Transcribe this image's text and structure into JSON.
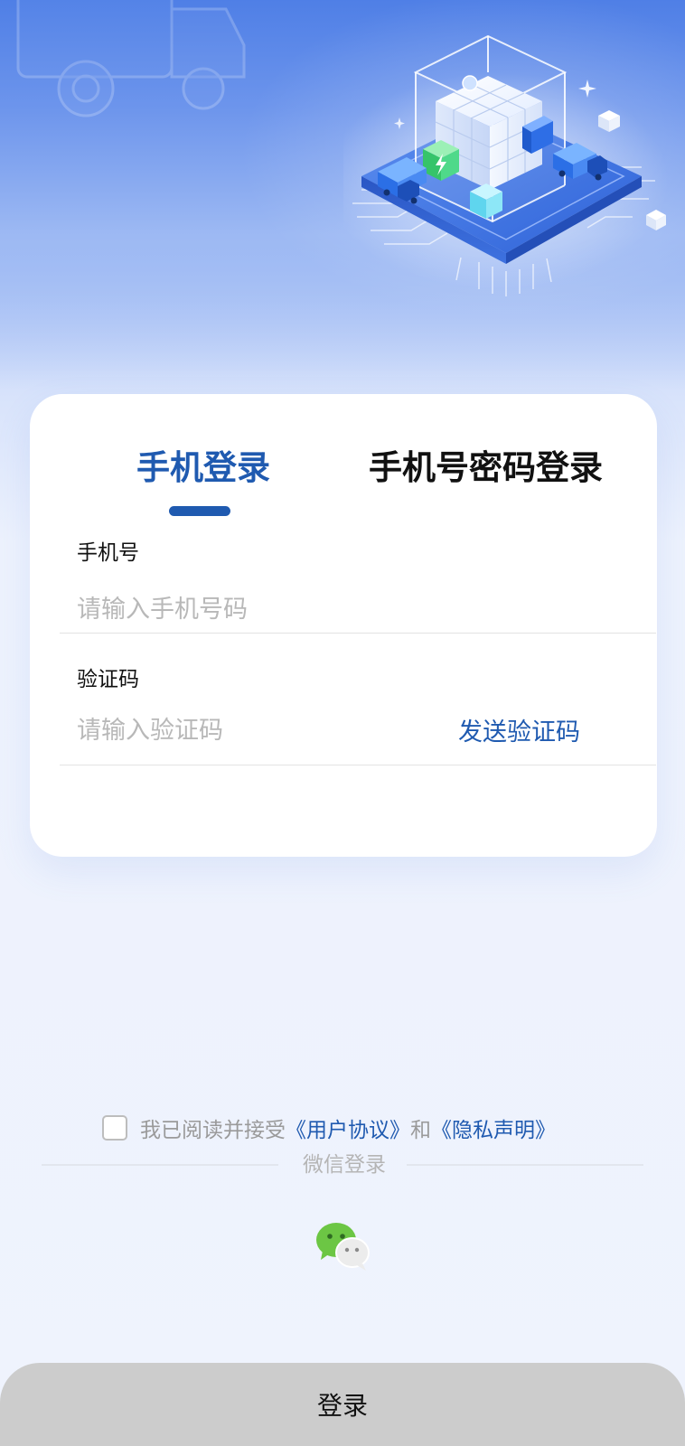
{
  "tabs": {
    "sms_login": "手机登录",
    "password_login": "手机号密码登录"
  },
  "phone": {
    "label": "手机号",
    "placeholder": "请输入手机号码"
  },
  "code": {
    "label": "验证码",
    "placeholder": "请输入验证码",
    "send_label": "发送验证码"
  },
  "agreement": {
    "prefix": "我已阅读并接受",
    "user_agreement": "《用户协议》",
    "conjunction": "和",
    "privacy_statement": "《隐私声明》"
  },
  "wechat": {
    "label": "微信登录"
  },
  "login": {
    "label": "登录"
  },
  "colors": {
    "accent": "#1f5ab0",
    "wechat_green": "#6cc644",
    "login_bar": "#cccccc"
  },
  "icons": [
    "wechat-icon",
    "isometric-cube-illustration",
    "truck-illustration"
  ]
}
